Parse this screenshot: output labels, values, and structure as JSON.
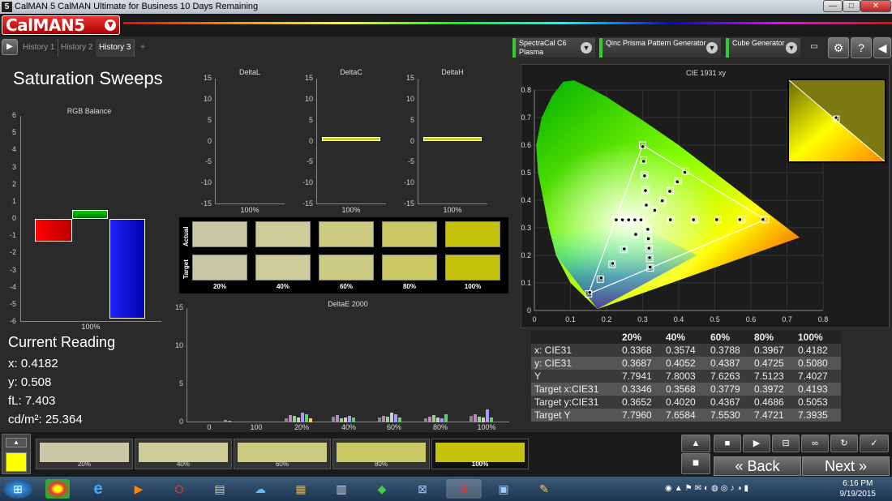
{
  "window": {
    "title": "CalMAN 5 CalMAN Ultimate for Business 10 Days Remaining",
    "min": "—",
    "max": "□",
    "close": "✕"
  },
  "logo": "CalMAN5",
  "tabs": [
    "History 1",
    "History 2",
    "History 3",
    "+"
  ],
  "devices": [
    {
      "line1": "SpectraCal C6",
      "line2": "Plasma"
    },
    {
      "line1": "Qinc Prisma Pattern Generator",
      "line2": ""
    },
    {
      "line1": "Cube Generator",
      "line2": ""
    }
  ],
  "page_title": "Saturation Sweeps",
  "rgb_balance": {
    "title": "RGB Balance",
    "yticks": [
      "6",
      "5",
      "4",
      "3",
      "2",
      "1",
      "0",
      "-1",
      "-2",
      "-3",
      "-4",
      "-5",
      "-6"
    ],
    "xlabel": "100%",
    "values": {
      "red": -1.3,
      "green": 0.5,
      "blue": -5.8
    }
  },
  "delta_charts": [
    {
      "title": "DeltaL",
      "value": 0,
      "xlabel": "100%"
    },
    {
      "title": "DeltaC",
      "value": 0.5,
      "xlabel": "100%"
    },
    {
      "title": "DeltaH",
      "value": 0.5,
      "xlabel": "100%"
    }
  ],
  "delta_yticks": [
    "15",
    "10",
    "5",
    "0",
    "-5",
    "-10",
    "-15"
  ],
  "swatches": {
    "actual_label": "Actual",
    "target_label": "Target",
    "labels": [
      "20%",
      "40%",
      "60%",
      "80%",
      "100%"
    ],
    "actual": [
      "#c8c7a6",
      "#cdcb98",
      "#cdcb82",
      "#cbc965",
      "#c4c20a"
    ],
    "target": [
      "#c8c7a6",
      "#cdcb99",
      "#cccb83",
      "#cbc966",
      "#c4c20b"
    ]
  },
  "deltae": {
    "title": "DeltaE 2000",
    "yticks": [
      "15",
      "10",
      "5",
      "0"
    ],
    "xlabels": [
      "0",
      "100",
      "20%",
      "40%",
      "60%",
      "80%",
      "100%"
    ]
  },
  "current_reading": {
    "title": "Current Reading",
    "x": "x: 0.4182",
    "y": "y: 0.508",
    "fl": "fL: 7.403",
    "cd": "cd/m²: 25.364"
  },
  "cie": {
    "title": "CIE 1931 xy",
    "yticks": [
      "0.8",
      "0.7",
      "0.6",
      "0.5",
      "0.4",
      "0.3",
      "0.2",
      "0.1",
      "0"
    ],
    "xticks": [
      "0",
      "0.1",
      "0.2",
      "0.3",
      "0.4",
      "0.5",
      "0.6",
      "0.7",
      "0.8"
    ]
  },
  "table": {
    "headers": [
      "",
      "20%",
      "40%",
      "60%",
      "80%",
      "100%"
    ],
    "rows": [
      [
        "x: CIE31",
        "0.3368",
        "0.3574",
        "0.3788",
        "0.3967",
        "0.4182"
      ],
      [
        "y: CIE31",
        "0.3687",
        "0.4052",
        "0.4387",
        "0.4725",
        "0.5080"
      ],
      [
        "Y",
        "7.7941",
        "7.8003",
        "7.6263",
        "7.5123",
        "7.4027"
      ],
      [
        "Target x:CIE31",
        "0.3346",
        "0.3568",
        "0.3779",
        "0.3972",
        "0.4193"
      ],
      [
        "Target y:CIE31",
        "0.3652",
        "0.4020",
        "0.4367",
        "0.4686",
        "0.5053"
      ],
      [
        "Target Y",
        "7.7960",
        "7.6584",
        "7.5530",
        "7.4721",
        "7.3935"
      ]
    ]
  },
  "bottom_swatches": [
    {
      "label": "20%",
      "color": "#c8c7a6"
    },
    {
      "label": "40%",
      "color": "#cdcb98"
    },
    {
      "label": "60%",
      "color": "#cdcb82"
    },
    {
      "label": "80%",
      "color": "#cbc965"
    },
    {
      "label": "100%",
      "color": "#c4c20a"
    }
  ],
  "nav": {
    "back": "Back",
    "next": "Next"
  },
  "clock": {
    "time": "6:16 PM",
    "date": "9/19/2015"
  }
}
